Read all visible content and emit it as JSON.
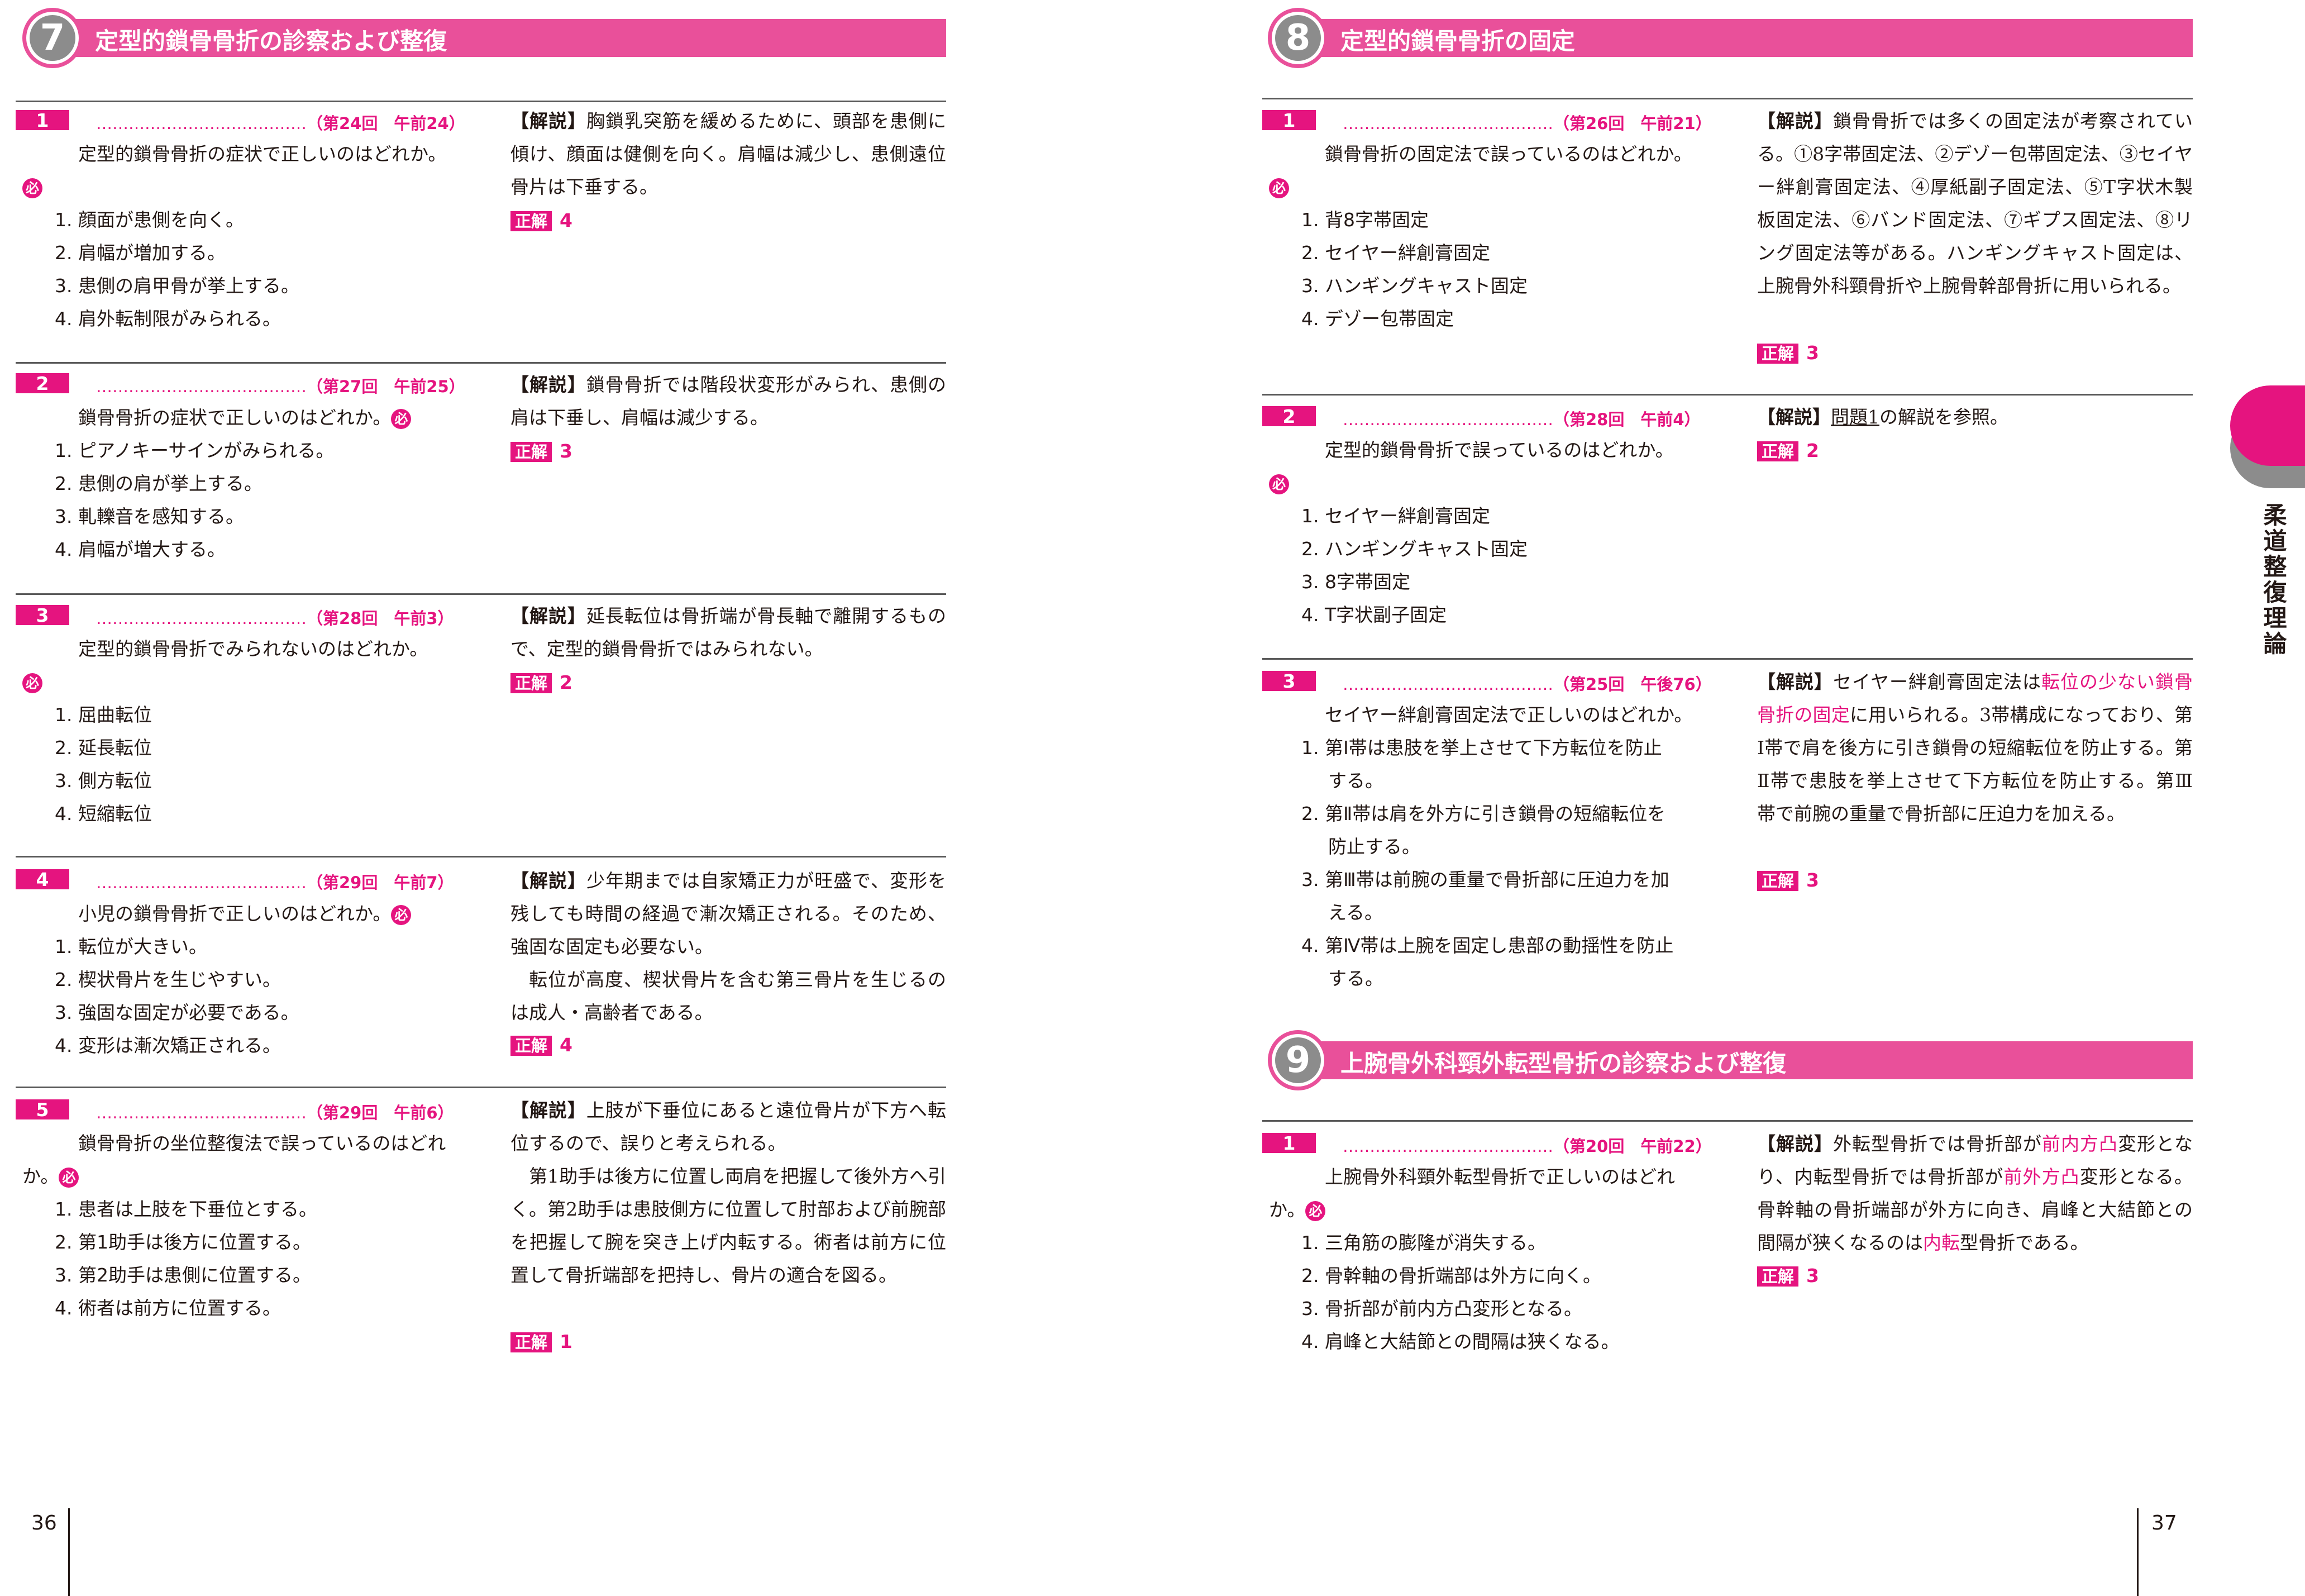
{
  "left_page": {
    "page_number": "36",
    "section": {
      "number": "7",
      "title": "定型的鎖骨骨折の診察および整復"
    },
    "questions": [
      {
        "num": "1",
        "source": "（第24回　午前24）",
        "text": "定型的鎖骨骨折の症状で正しいのはどれか。",
        "must": "必",
        "options": [
          "1. 顔面が患側を向く。",
          "2. 肩幅が増加する。",
          "3. 患側の肩甲骨が挙上する。",
          "4. 肩外転制限がみられる。"
        ],
        "exp_tag": "【解説】",
        "exp": "胸鎖乳突筋を緩めるために、頭部を患側に傾け、顔面は健側を向く。肩幅は減少し、患側遠位骨片は下垂する。",
        "ans_label": "正解",
        "ans": "4"
      },
      {
        "num": "2",
        "source": "（第27回　午前25）",
        "text": "鎖骨骨折の症状で正しいのはどれか。",
        "must": "必",
        "options": [
          "1. ピアノキーサインがみられる。",
          "2. 患側の肩が挙上する。",
          "3. 軋轢音を感知する。",
          "4. 肩幅が増大する。"
        ],
        "exp_tag": "【解説】",
        "exp": "鎖骨骨折では階段状変形がみられ、患側の肩は下垂し、肩幅は減少する。",
        "ans_label": "正解",
        "ans": "3"
      },
      {
        "num": "3",
        "source": "（第28回　午前3）",
        "text": "定型的鎖骨骨折でみられないのはどれか。",
        "must": "必",
        "options": [
          "1. 屈曲転位",
          "2. 延長転位",
          "3. 側方転位",
          "4. 短縮転位"
        ],
        "exp_tag": "【解説】",
        "exp": "延長転位は骨折端が骨長軸で離開するもので、定型的鎖骨骨折ではみられない。",
        "ans_label": "正解",
        "ans": "2"
      },
      {
        "num": "4",
        "source": "（第29回　午前7）",
        "text": "小児の鎖骨骨折で正しいのはどれか。",
        "must": "必",
        "options": [
          "1. 転位が大きい。",
          "2. 楔状骨片を生じやすい。",
          "3. 強固な固定が必要である。",
          "4. 変形は漸次矯正される。"
        ],
        "exp_tag": "【解説】",
        "exp": "少年期までは自家矯正力が旺盛で、変形を残しても時間の経過で漸次矯正される。そのため、強固な固定も必要ない。",
        "exp2": "転位が高度、楔状骨片を含む第三骨片を生じるのは成人・高齢者である。",
        "ans_label": "正解",
        "ans": "4"
      },
      {
        "num": "5",
        "source": "（第29回　午前6）",
        "text": "鎖骨骨折の坐位整復法で誤っているのはどれか。",
        "must": "必",
        "options": [
          "1. 患者は上肢を下垂位とする。",
          "2. 第1助手は後方に位置する。",
          "3. 第2助手は患側に位置する。",
          "4. 術者は前方に位置する。"
        ],
        "exp_tag": "【解説】",
        "exp": "上肢が下垂位にあると遠位骨片が下方へ転位するので、誤りと考えられる。",
        "exp2": "第1助手は後方に位置し両肩を把握して後外方へ引く。第2助手は患肢側方に位置して肘部および前腕部を把握して腕を突き上げ内転する。術者は前方に位置して骨折端部を把持し、骨片の適合を図る。",
        "ans_label": "正解",
        "ans": "1"
      }
    ]
  },
  "right_page": {
    "page_number": "37",
    "side_tab": "柔道整復理論",
    "section8": {
      "number": "8",
      "title": "定型的鎖骨骨折の固定"
    },
    "questions8": [
      {
        "num": "1",
        "source": "（第26回　午前21）",
        "text": "鎖骨骨折の固定法で誤っているのはどれか。",
        "must": "必",
        "options": [
          "1. 背8字帯固定",
          "2. セイヤー絆創膏固定",
          "3. ハンギングキャスト固定",
          "4. デゾー包帯固定"
        ],
        "exp_tag": "【解説】",
        "exp": "鎖骨骨折では多くの固定法が考察されている。①8字帯固定法、②デゾー包帯固定法、③セイヤー絆創膏固定法、④厚紙副子固定法、⑤T字状木製板固定法、⑥バンド固定法、⑦ギプス固定法、⑧リング固定法等がある。ハンギングキャスト固定は、上腕骨外科頸骨折や上腕骨幹部骨折に用いられる。",
        "ans_label": "正解",
        "ans": "3"
      },
      {
        "num": "2",
        "source": "（第28回　午前4）",
        "text": "定型的鎖骨骨折で誤っているのはどれか。",
        "must": "必",
        "options": [
          "1. セイヤー絆創膏固定",
          "2. ハンギングキャスト固定",
          "3. 8字帯固定",
          "4. T字状副子固定"
        ],
        "exp_tag": "【解説】",
        "exp_ref": "問題1",
        "exp": "の解説を参照。",
        "ans_label": "正解",
        "ans": "2"
      },
      {
        "num": "3",
        "source": "（第25回　午後76）",
        "text": "セイヤー絆創膏固定法で正しいのはどれか。",
        "options": [
          [
            "1. 第Ⅰ帯は患肢を挙上させて下方転位を防止",
            "する。"
          ],
          [
            "2. 第Ⅱ帯は肩を外方に引き鎖骨の短縮転位を",
            "防止する。"
          ],
          [
            "3. 第Ⅲ帯は前腕の重量で骨折部に圧迫力を加",
            "える。"
          ],
          [
            "4. 第Ⅳ帯は上腕を固定し患部の動揺性を防止",
            "する。"
          ]
        ],
        "exp_tag": "【解説】",
        "exp_a": "セイヤー絆創膏固定法は",
        "exp_pink": "転位の少ない鎖骨骨折の固定",
        "exp_b": "に用いられる。3帯構成になっており、第Ⅰ帯で肩を後方に引き鎖骨の短縮転位を防止する。第Ⅱ帯で患肢を挙上させて下方転位を防止する。第Ⅲ帯で前腕の重量で骨折部に圧迫力を加える。",
        "ans_label": "正解",
        "ans": "3"
      }
    ],
    "section9": {
      "number": "9",
      "title": "上腕骨外科頸外転型骨折の診察および整復"
    },
    "questions9": [
      {
        "num": "1",
        "source": "（第20回　午前22）",
        "text": "上腕骨外科頸外転型骨折で正しいのはどれか。",
        "must": "必",
        "options": [
          "1. 三角筋の膨隆が消失する。",
          "2. 骨幹軸の骨折端部は外方に向く。",
          "3. 骨折部が前内方凸変形となる。",
          "4. 肩峰と大結節との間隔は狭くなる。"
        ],
        "exp_tag": "【解説】",
        "exp_1": "外転型骨折では骨折部が",
        "exp_p1": "前内方凸",
        "exp_2": "変形となり、内転型骨折では骨折部が",
        "exp_p2": "前外方凸",
        "exp_3": "変形となる。骨幹軸の骨折端部が外方に向き、肩峰と大結節との間隔が狭くなるのは",
        "exp_p3": "内転",
        "exp_4": "型骨折である。",
        "ans_label": "正解",
        "ans": "3"
      }
    ]
  }
}
